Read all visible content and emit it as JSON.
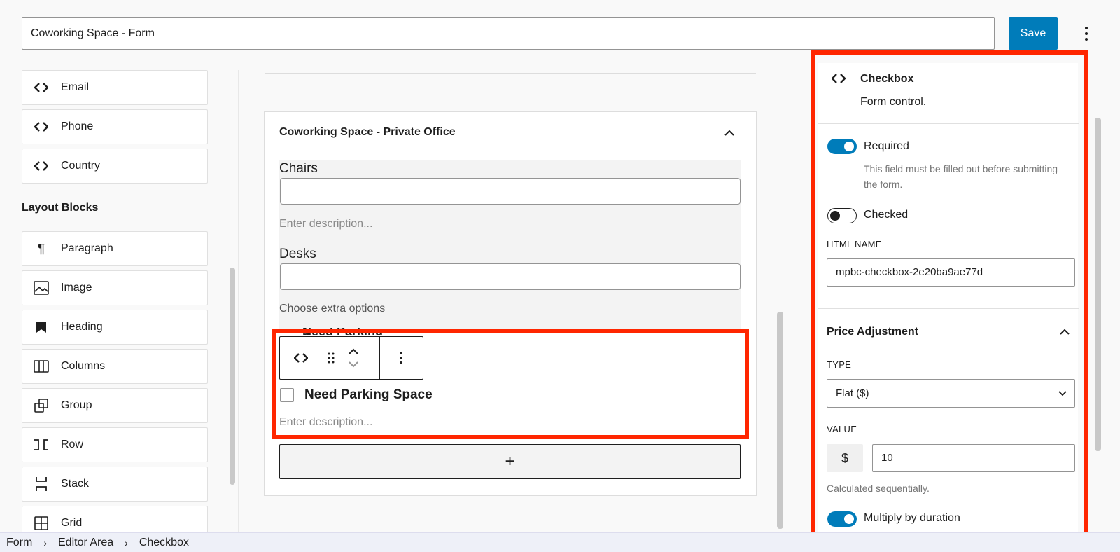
{
  "header": {
    "form_title": "Coworking Space - Form",
    "save_label": "Save"
  },
  "left_sidebar": {
    "field_blocks": [
      {
        "label": "Email",
        "icon": "code-icon"
      },
      {
        "label": "Phone",
        "icon": "code-icon"
      },
      {
        "label": "Country",
        "icon": "code-icon"
      }
    ],
    "layout_heading": "Layout Blocks",
    "layout_blocks": [
      {
        "label": "Paragraph",
        "icon": "paragraph-icon"
      },
      {
        "label": "Image",
        "icon": "image-icon"
      },
      {
        "label": "Heading",
        "icon": "heading-icon"
      },
      {
        "label": "Columns",
        "icon": "columns-icon"
      },
      {
        "label": "Group",
        "icon": "group-icon"
      },
      {
        "label": "Row",
        "icon": "row-icon"
      },
      {
        "label": "Stack",
        "icon": "stack-icon"
      },
      {
        "label": "Grid",
        "icon": "grid-icon"
      }
    ]
  },
  "canvas": {
    "card_title": "Coworking Space - Private Office",
    "fields": [
      {
        "label": "Chairs",
        "description_placeholder": "Enter description..."
      },
      {
        "label": "Desks"
      }
    ],
    "extra_options_label": "Choose extra options",
    "checkbox_label": "Need Parking Space",
    "checkbox_description_placeholder": "Enter description...",
    "add_block_symbol": "+"
  },
  "inspector": {
    "block_title": "Checkbox",
    "block_description": "Form control.",
    "required_label": "Required",
    "required_on": true,
    "required_help": "This field must be filled out before submitting the form.",
    "checked_label": "Checked",
    "checked_on": false,
    "html_name_label": "HTML NAME",
    "html_name_value": "mpbc-checkbox-2e20ba9ae77d",
    "price_panel_title": "Price Adjustment",
    "type_label": "TYPE",
    "type_value": "Flat ($)",
    "value_label": "VALUE",
    "value_prefix": "$",
    "value_value": "10",
    "calc_help": "Calculated sequentially.",
    "multiply_label": "Multiply by duration",
    "multiply_on": true
  },
  "breadcrumb": [
    "Form",
    "Editor Area",
    "Checkbox"
  ],
  "colors": {
    "accent": "#007cba",
    "highlight": "#ff2600"
  }
}
